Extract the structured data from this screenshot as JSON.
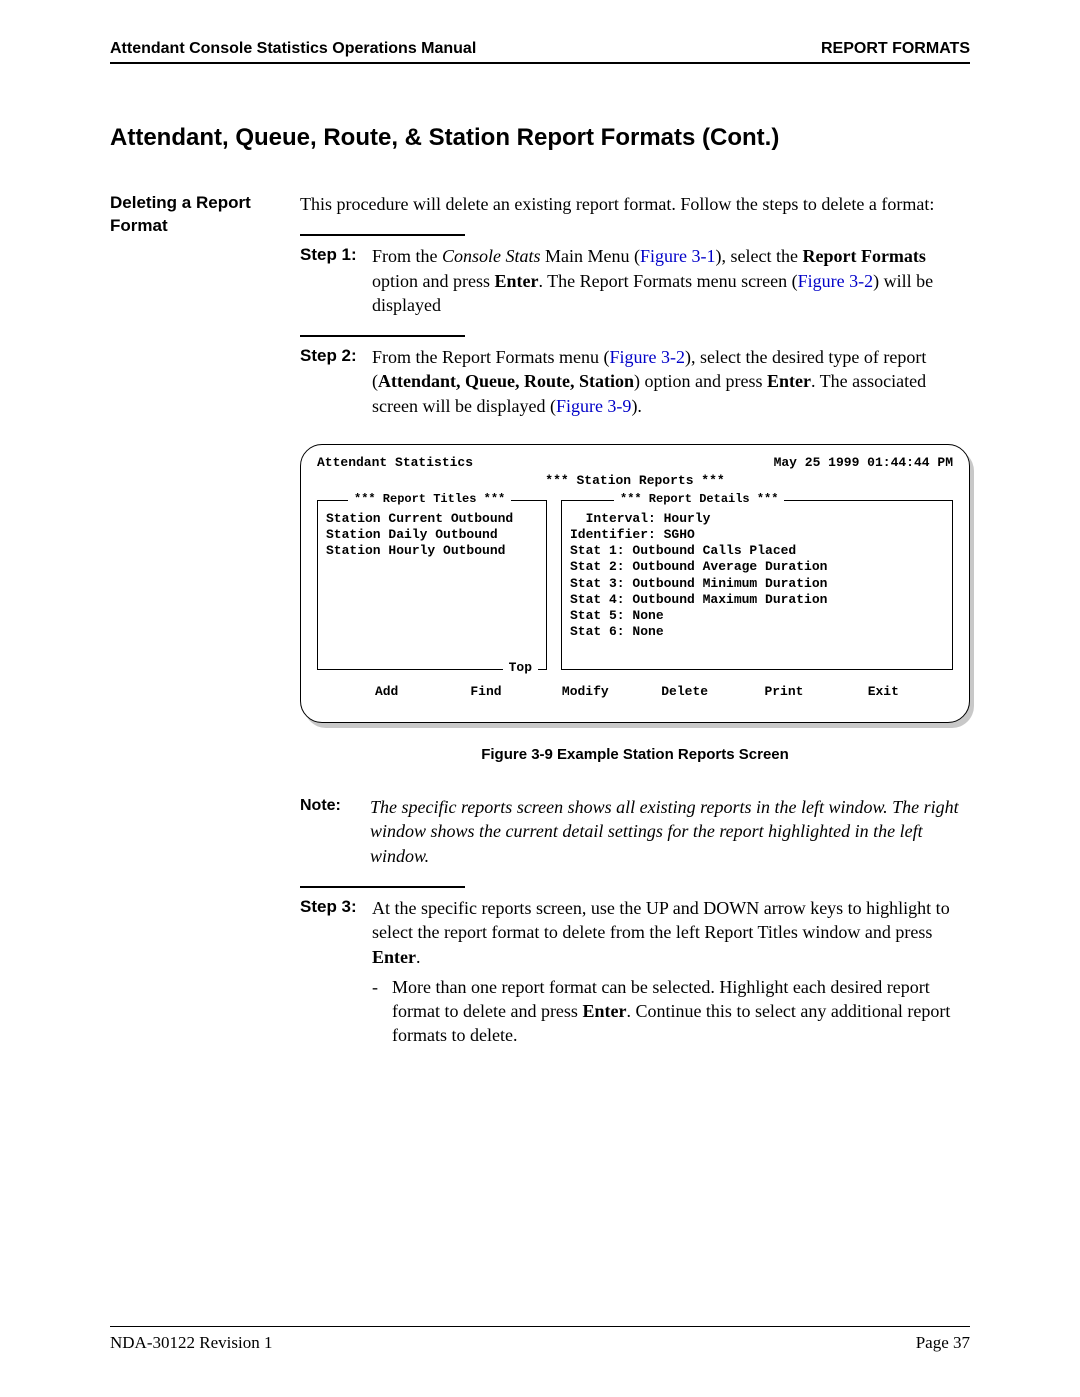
{
  "header": {
    "left": "Attendant Console Statistics Operations Manual",
    "right": "REPORT FORMATS"
  },
  "section_title": "Attendant, Queue, Route, & Station Report Formats (Cont.)",
  "left_heading": "Deleting a Report Format",
  "intro": "This procedure will delete an existing report format. Follow the steps to delete a format:",
  "steps": {
    "s1": {
      "label": "Step 1:",
      "a": "From the ",
      "b_ital": "Console Stats",
      "c": " Main Menu (",
      "link1": "Figure 3-1",
      "d": "), select the ",
      "bold1": "Report Formats",
      "e": " option and press ",
      "bold2": "Enter",
      "f": ". The Report Formats menu screen (",
      "link2": "Figure 3-2",
      "g": ") will be displayed"
    },
    "s2": {
      "label": "Step 2:",
      "a": "From the Report Formats menu (",
      "link1": "Figure 3-2",
      "b": "), select the desired type of report (",
      "bold1": "Attendant, Queue, Route, Station",
      "c": ") option and press ",
      "bold2": "Enter",
      "d": ". The associated screen will be displayed (",
      "link2": "Figure 3-9",
      "e": ")."
    },
    "s3": {
      "label": "Step 3:",
      "a": "At the specific reports screen, use the UP and DOWN arrow keys to highlight to select the report format to delete from the left Report Titles window and press ",
      "bold1": "Enter",
      "b": ".",
      "bullet_a": "More than one report format can be selected. Highlight each desired report format to delete and press ",
      "bullet_bold": "Enter",
      "bullet_b": ". Continue this to select any additional report formats to delete."
    }
  },
  "terminal": {
    "top_left": "Attendant Statistics",
    "top_right": "May 25 1999  01:44:44 PM",
    "title": "*** Station Reports ***",
    "left_legend": "*** Report Titles ***",
    "right_legend": "*** Report Details ***",
    "left_lines": [
      "Station Current Outbound",
      "Station Daily Outbound",
      "Station Hourly Outbound"
    ],
    "right_lines": [
      "  Interval: Hourly",
      "Identifier: SGHO",
      "",
      "Stat 1: Outbound Calls Placed",
      "Stat 2: Outbound Average Duration",
      "Stat 3: Outbound Minimum Duration",
      "Stat 4: Outbound Maximum Duration",
      "Stat 5: None",
      "Stat 6: None"
    ],
    "bottom_legend": "Top",
    "actions": [
      "Add",
      "Find",
      "Modify",
      "Delete",
      "Print",
      "Exit"
    ]
  },
  "figure_caption": "Figure 3-9   Example Station Reports Screen",
  "note": {
    "label": "Note:",
    "text": "The specific reports screen shows all existing reports in the left window. The right window shows the current detail settings for the report highlighted in the left window."
  },
  "footer": {
    "left": "NDA-30122   Revision 1",
    "right": "Page 37"
  }
}
